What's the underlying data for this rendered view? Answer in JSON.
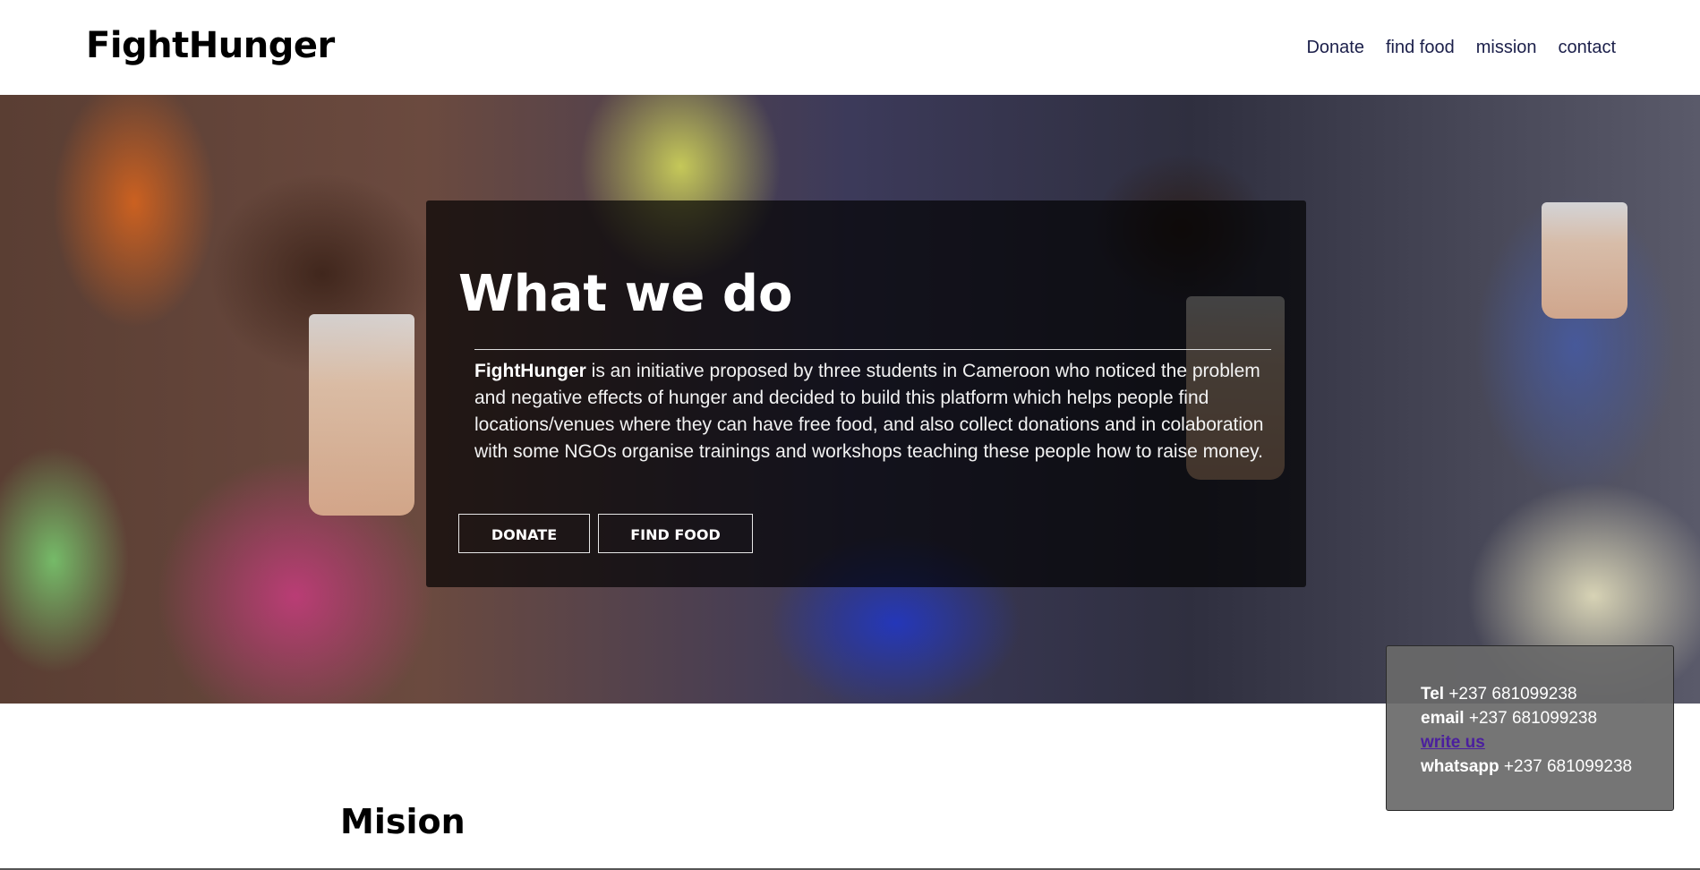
{
  "header": {
    "brand": "FightHunger",
    "nav": [
      "Donate",
      "find food",
      "mission",
      "contact"
    ]
  },
  "hero": {
    "title": "What we do",
    "intro_bold": "FightHunger",
    "intro_text": " is an initiative proposed by three students in Cameroon who noticed the problem and negative effects of hunger and decided to build this platform which helps people find locations/venues where they can have free food, and also collect donations and in colaboration with some NGOs organise trainings and workshops teaching these people how to raise money.",
    "buttons": {
      "donate": "DONATE",
      "find_food": "FIND FOOD"
    }
  },
  "contact": {
    "tel_label": "Tel",
    "tel_value": "+237 681099238",
    "email_label": "email",
    "email_value": "+237 681099238",
    "write_us": "write us",
    "whatsapp_label": "whatsapp",
    "whatsapp_value": "+237 681099238"
  },
  "mission": {
    "title": "Mision"
  }
}
